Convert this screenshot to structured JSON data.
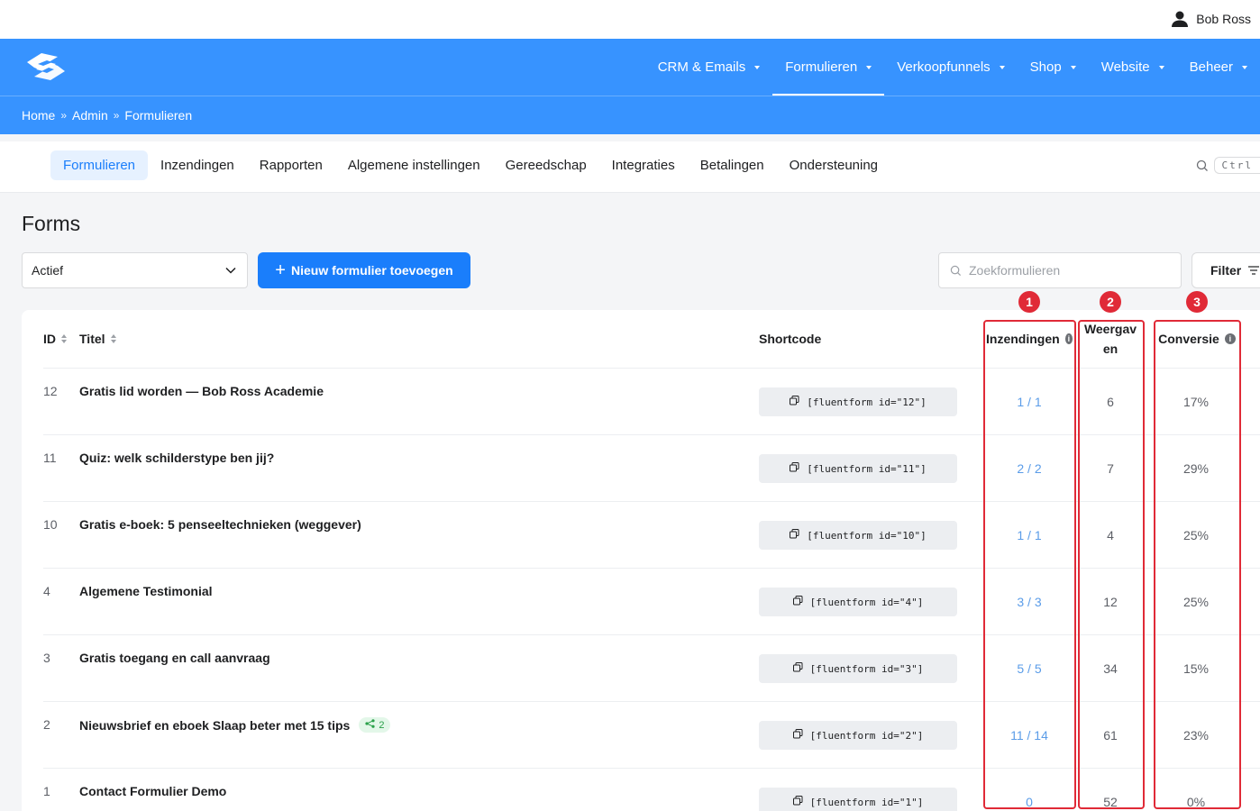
{
  "user": {
    "name": "Bob Ross"
  },
  "nav": {
    "items": [
      {
        "label": "CRM & Emails",
        "active": false
      },
      {
        "label": "Formulieren",
        "active": true
      },
      {
        "label": "Verkoopfunnels",
        "active": false
      },
      {
        "label": "Shop",
        "active": false
      },
      {
        "label": "Website",
        "active": false
      },
      {
        "label": "Beheer",
        "active": false
      }
    ]
  },
  "breadcrumb": [
    "Home",
    "Admin",
    "Formulieren"
  ],
  "breadcrumb_sep": "»",
  "subnav": {
    "items": [
      "Formulieren",
      "Inzendingen",
      "Rapporten",
      "Algemene instellingen",
      "Gereedschap",
      "Integraties",
      "Betalingen",
      "Ondersteuning"
    ],
    "active_index": 0,
    "search_shortcut": "Ctrl"
  },
  "page": {
    "title": "Forms",
    "status_select": "Actief",
    "add_button": "Nieuw formulier toevoegen",
    "search_placeholder": "Zoekformulieren",
    "filter_label": "Filter"
  },
  "table": {
    "headers": {
      "id": "ID",
      "title": "Titel",
      "shortcode": "Shortcode",
      "submissions": "Inzendingen",
      "views_line1": "Weergav",
      "views_line2": "en",
      "conversion": "Conversie"
    },
    "rows": [
      {
        "id": "12",
        "title": "Gratis lid worden — Bob Ross Academie",
        "shortcode": "[fluentform id=\"12\"]",
        "submissions": "1 / 1",
        "views": "6",
        "conversion": "17%",
        "badge": ""
      },
      {
        "id": "11",
        "title": "Quiz: welk schilderstype ben jij?",
        "shortcode": "[fluentform id=\"11\"]",
        "submissions": "2 / 2",
        "views": "7",
        "conversion": "29%",
        "badge": ""
      },
      {
        "id": "10",
        "title": "Gratis e-boek: 5 penseeltechnieken (weggever)",
        "shortcode": "[fluentform id=\"10\"]",
        "submissions": "1 / 1",
        "views": "4",
        "conversion": "25%",
        "badge": ""
      },
      {
        "id": "4",
        "title": "Algemene Testimonial",
        "shortcode": "[fluentform id=\"4\"]",
        "submissions": "3 / 3",
        "views": "12",
        "conversion": "25%",
        "badge": ""
      },
      {
        "id": "3",
        "title": "Gratis toegang en call aanvraag",
        "shortcode": "[fluentform id=\"3\"]",
        "submissions": "5 / 5",
        "views": "34",
        "conversion": "15%",
        "badge": ""
      },
      {
        "id": "2",
        "title": "Nieuwsbrief en eboek Slaap beter met 15 tips",
        "shortcode": "[fluentform id=\"2\"]",
        "submissions": "11 / 14",
        "views": "61",
        "conversion": "23%",
        "badge": "2"
      },
      {
        "id": "1",
        "title": "Contact Formulier Demo",
        "shortcode": "[fluentform id=\"1\"]",
        "submissions": "0",
        "views": "52",
        "conversion": "0%",
        "badge": ""
      }
    ]
  },
  "annotations": {
    "markers": [
      "1",
      "2",
      "3"
    ],
    "color": "#e02a37"
  },
  "colors": {
    "brand_blue": "#3793ff",
    "primary_button": "#1a7efb",
    "link_blue": "#5a9ce8"
  }
}
